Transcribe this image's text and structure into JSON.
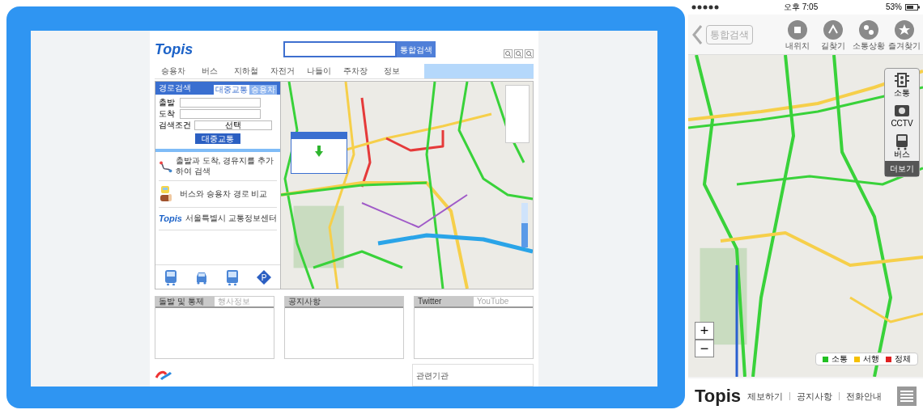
{
  "website": {
    "logo": "Topis",
    "search_button": "통합검색",
    "nav": [
      "승용차",
      "버스",
      "지하철",
      "자전거",
      "나들이",
      "주차장",
      "정보"
    ],
    "route_panel": {
      "title": "경로검색",
      "tabs": [
        {
          "label": "대중교통",
          "selected": true
        },
        {
          "label": "승용차",
          "selected": false
        }
      ],
      "fields": [
        {
          "label": "출발"
        },
        {
          "label": "도착"
        }
      ],
      "condition_label": "검색조건",
      "condition_value": "선택",
      "submit": "대중교통"
    },
    "features": [
      {
        "kind": "route",
        "title": "출발과 도착, 경유지를 추가하여 검색"
      },
      {
        "kind": "compare",
        "title": "버스와 승용차 경로 비교"
      },
      {
        "kind": "logo",
        "logo": "Topis",
        "title": "서울특별시 교통정보센터"
      }
    ],
    "bottom_panels": [
      {
        "tabs": [
          {
            "label": "돌발 및 통제",
            "selected": true
          },
          {
            "label": "행사정보",
            "selected": false
          }
        ]
      },
      {
        "tabs": [
          {
            "label": "공지사항",
            "selected": true
          }
        ]
      },
      {
        "tabs": [
          {
            "label": "Twitter",
            "selected": true
          },
          {
            "label": "YouTube",
            "selected": false
          }
        ]
      }
    ],
    "related_title": "관련기관",
    "parking_label": "P",
    "map_zoom": {
      "level": 0.55
    }
  },
  "phone": {
    "status": {
      "time": "오후 7:05",
      "battery": "53%"
    },
    "search": "통합검색",
    "actions": [
      {
        "kind": "location",
        "label": "내위치"
      },
      {
        "kind": "route",
        "label": "길찾기"
      },
      {
        "kind": "traffic",
        "label": "소통상황"
      },
      {
        "kind": "star",
        "label": "즐겨찾기"
      }
    ],
    "layers": [
      {
        "kind": "traffic",
        "label": "소통"
      },
      {
        "kind": "cctv",
        "label": "CCTV"
      },
      {
        "kind": "bus",
        "label": "버스"
      }
    ],
    "more": "더보기",
    "zoom_in": "+",
    "zoom_out": "−",
    "legend": [
      {
        "label": "소통",
        "color": "#22c022"
      },
      {
        "label": "서행",
        "color": "#f5c000"
      },
      {
        "label": "정체",
        "color": "#e02020"
      }
    ],
    "logo": "Topis",
    "links": [
      "제보하기",
      "공지사항",
      "전화안내"
    ]
  }
}
